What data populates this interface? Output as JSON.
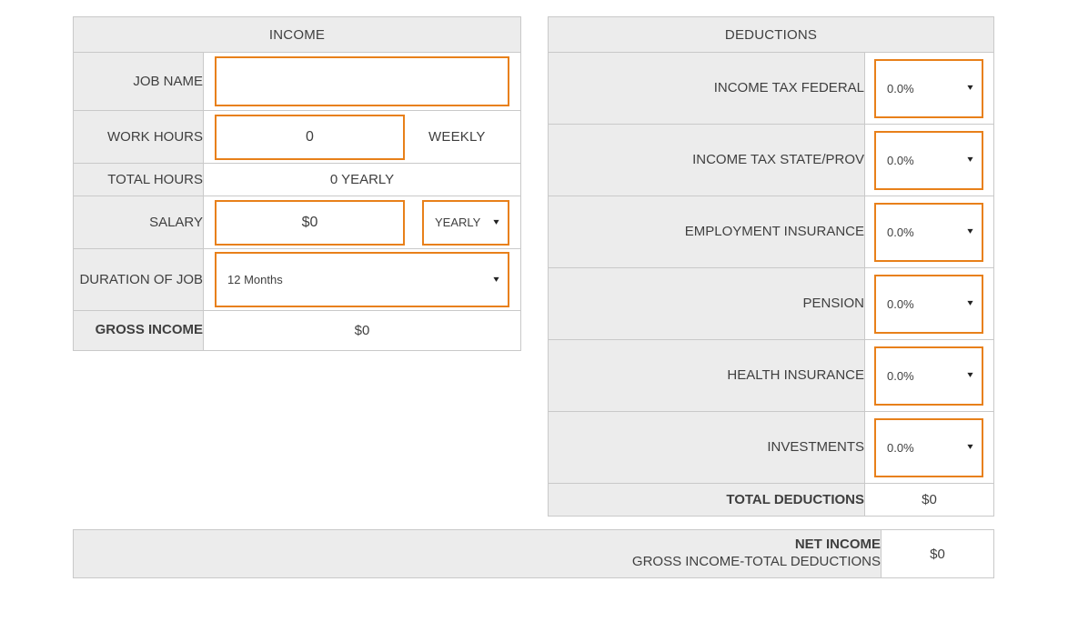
{
  "income": {
    "title": "INCOME",
    "rows": {
      "job_name": {
        "label": "JOB NAME",
        "value": ""
      },
      "work_hours": {
        "label": "WORK HOURS",
        "value": "0",
        "unit": "WEEKLY"
      },
      "total_hours": {
        "label": "TOTAL HOURS",
        "value": "0 YEARLY"
      },
      "salary": {
        "label": "SALARY",
        "value": "$0",
        "period": "YEARLY"
      },
      "duration": {
        "label": "DURATION OF JOB",
        "value": "12 Months"
      },
      "gross_income": {
        "label": "GROSS INCOME",
        "value": "$0"
      }
    }
  },
  "deductions": {
    "title": "DEDUCTIONS",
    "rows": [
      {
        "label": "INCOME TAX FEDERAL",
        "value": "0.0%"
      },
      {
        "label": "INCOME TAX STATE/PROV",
        "value": "0.0%"
      },
      {
        "label": "EMPLOYMENT INSURANCE",
        "value": "0.0%"
      },
      {
        "label": "PENSION",
        "value": "0.0%"
      },
      {
        "label": "HEALTH INSURANCE",
        "value": "0.0%"
      },
      {
        "label": "INVESTMENTS",
        "value": "0.0%"
      }
    ],
    "total": {
      "label": "TOTAL DEDUCTIONS",
      "value": "$0"
    }
  },
  "net": {
    "label": "NET INCOME",
    "formula": "GROSS INCOME-TOTAL DEDUCTIONS",
    "value": "$0"
  },
  "icons": {
    "caret": "▾"
  },
  "colors": {
    "accent": "#e8801a",
    "label_bg": "#ececec",
    "border": "#c9c9c9",
    "text": "#3f3f3f"
  }
}
